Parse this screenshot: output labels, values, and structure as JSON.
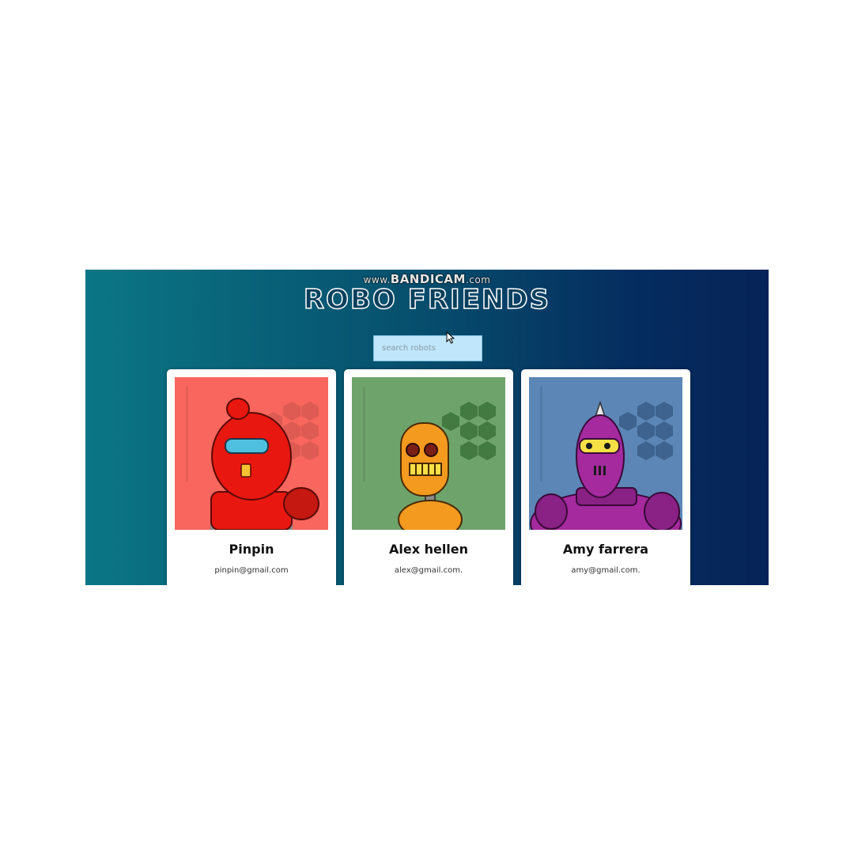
{
  "watermark": {
    "prefix": "www.",
    "brand": "BANDICAM",
    "suffix": ".com"
  },
  "app": {
    "title": "ROBO FRIENDS",
    "search": {
      "placeholder": "search robots",
      "value": ""
    },
    "cursor_icon": "mouse-pointer-icon"
  },
  "robots": [
    {
      "name": "Pinpin",
      "email": "pinpin@gmail.com",
      "bg": "#f8665d",
      "robot_color": "#e8170f",
      "icon": "red-robot-avatar"
    },
    {
      "name": "Alex hellen",
      "email": "alex@gmail.com.",
      "bg": "#6fa36c",
      "robot_color": "#f39a1f",
      "icon": "orange-robot-avatar"
    },
    {
      "name": "Amy farrera",
      "email": "amy@gmail.com.",
      "bg": "#5b86b6",
      "robot_color": "#a42a9e",
      "icon": "purple-robot-avatar"
    }
  ]
}
